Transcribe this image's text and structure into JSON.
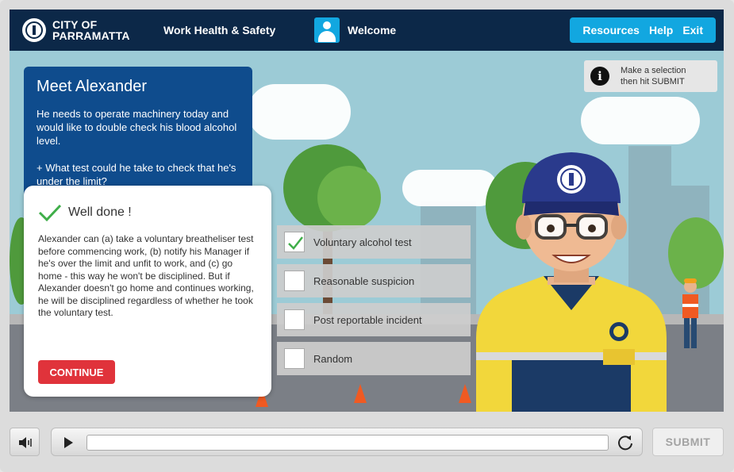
{
  "header": {
    "logo_line1": "CITY OF",
    "logo_line2": "PARRAMATTA",
    "course_title": "Work Health & Safety",
    "welcome": "Welcome",
    "nav": [
      {
        "label": "Resources"
      },
      {
        "label": "Help"
      },
      {
        "label": "Exit"
      }
    ]
  },
  "question": {
    "title": "Meet Alexander",
    "paragraph1": "He needs to operate machinery today and would like to double check his blood alcohol level.",
    "paragraph2": "+ What test could he take to check that he's under the limit?"
  },
  "hint": {
    "icon": "info-icon",
    "line1": "Make a selection",
    "line2": "then hit SUBMIT"
  },
  "options": [
    {
      "label": "Voluntary alcohol test",
      "checked": true
    },
    {
      "label": "Reasonable suspicion",
      "checked": false
    },
    {
      "label": "Post reportable incident",
      "checked": false
    },
    {
      "label": "Random",
      "checked": false
    }
  ],
  "feedback": {
    "icon": "check-icon",
    "title": "Well done !",
    "body": "Alexander can (a) take a voluntary breatheliser test before commencing work, (b) notify his Manager if he's over the limit and unfit to work, and (c) go home - this way he won't be disciplined.  But if Alexander doesn't go home and continues working, he will be disciplined regardless of whether he took the voluntary test.",
    "continue_label": "CONTINUE"
  },
  "controls": {
    "volume_icon": "speaker-icon",
    "play_icon": "play-icon",
    "replay_icon": "replay-icon",
    "submit_label": "SUBMIT"
  },
  "colors": {
    "header_bg": "#0c2848",
    "accent": "#12a7e0",
    "panel_bg": "#0f4c8d",
    "continue": "#e0333b",
    "check": "#3fae49"
  }
}
